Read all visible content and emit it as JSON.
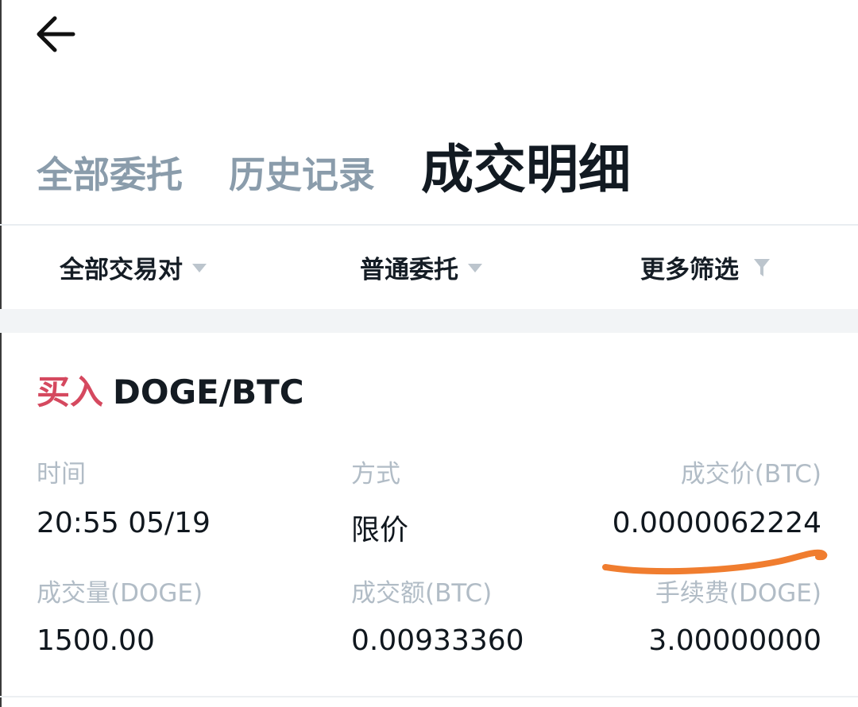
{
  "header": {
    "back_icon": "arrow-left-icon"
  },
  "tabs": [
    {
      "label": "全部委托",
      "active": false
    },
    {
      "label": "历史记录",
      "active": false
    },
    {
      "label": "成交明细",
      "active": true
    }
  ],
  "filters": {
    "pair": {
      "label": "全部交易对",
      "icon": "triangle-down-icon"
    },
    "order_type": {
      "label": "普通委托",
      "icon": "triangle-down-icon"
    },
    "more": {
      "label": "更多筛选",
      "icon": "funnel-icon"
    }
  },
  "trade": {
    "side": "买入",
    "pair": "DOGE/BTC",
    "fields": {
      "time_label": "时间",
      "time_value": "20:55 05/19",
      "method_label": "方式",
      "method_value": "限价",
      "price_label": "成交价(BTC)",
      "price_value": "0.0000062224",
      "volume_label": "成交量(DOGE)",
      "volume_value": "1500.00",
      "amount_label": "成交额(BTC)",
      "amount_value": "0.00933360",
      "fee_label": "手续费(DOGE)",
      "fee_value": "3.00000000"
    }
  },
  "colors": {
    "buy": "#d5495f",
    "active_tab": "#121a22",
    "inactive_tab": "#8a9cab",
    "field_label": "#b1bcc6",
    "annotation_stroke": "#f07d2f"
  }
}
